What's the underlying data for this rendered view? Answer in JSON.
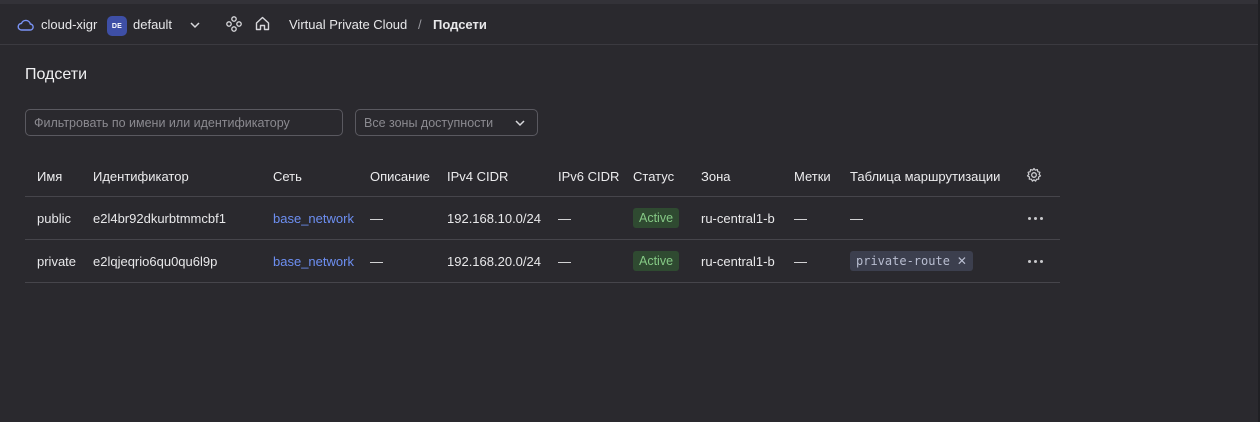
{
  "header": {
    "cloud_name": "cloud-xigr",
    "folder_badge": "DE",
    "folder_name": "default",
    "breadcrumb": [
      "Virtual Private Cloud",
      "Подсети"
    ],
    "breadcrumb_separator": "/"
  },
  "page": {
    "title": "Подсети",
    "filter_placeholder": "Фильтровать по имени или идентификатору",
    "zones_select": "Все зоны доступности"
  },
  "table": {
    "columns": [
      "Имя",
      "Идентификатор",
      "Сеть",
      "Описание",
      "IPv4 CIDR",
      "IPv6 CIDR",
      "Статус",
      "Зона",
      "Метки",
      "Таблица маршрутизации"
    ],
    "rows": [
      {
        "name": "public",
        "id": "e2l4br92dkurbtmmcbf1",
        "network": "base_network",
        "description": "—",
        "ipv4": "192.168.10.0/24",
        "ipv6": "—",
        "status": "Active",
        "zone": "ru-central1-b",
        "labels": "—",
        "route_table": "—"
      },
      {
        "name": "private",
        "id": "e2lqjeqrio6qu0qu6l9p",
        "network": "base_network",
        "description": "—",
        "ipv4": "192.168.20.0/24",
        "ipv6": "—",
        "status": "Active",
        "zone": "ru-central1-b",
        "labels": "—",
        "route_table": "private-route"
      }
    ]
  },
  "colors": {
    "background": "#2a292e",
    "link": "#6d8ff2",
    "status_active_bg": "#2f4a31",
    "status_active_text": "#85c985",
    "badge": "#3e4fa6"
  }
}
